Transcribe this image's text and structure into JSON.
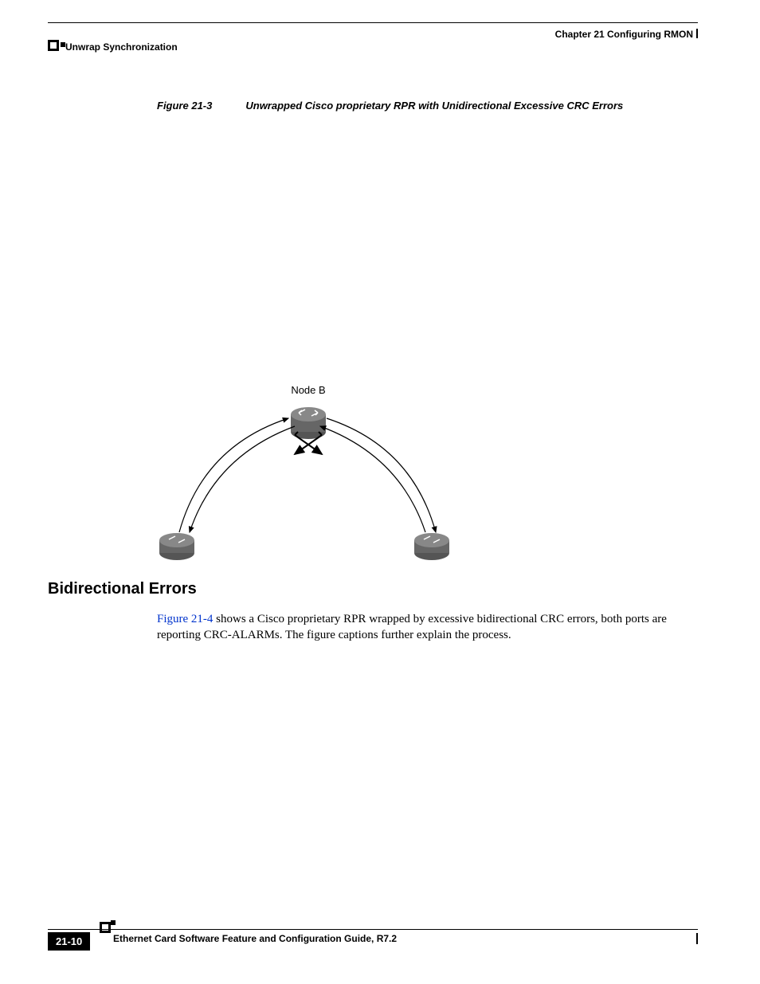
{
  "header": {
    "chapter": "Chapter 21 Configuring RMON",
    "section": "Unwrap Synchronization"
  },
  "figure": {
    "number": "Figure 21-3",
    "title": "Unwrapped Cisco proprietary RPR  with Unidirectional Excessive CRC Errors",
    "node_label": "Node B"
  },
  "heading": "Bidirectional Errors",
  "paragraph": {
    "link": "Figure 21-4",
    "rest": " shows a Cisco proprietary RPR wrapped by excessive bidirectional CRC errors, both ports are reporting CRC-ALARMs. The figure captions further explain the process."
  },
  "footer": {
    "title": "Ethernet Card Software Feature and Configuration Guide, R7.2",
    "page": "21-10"
  }
}
